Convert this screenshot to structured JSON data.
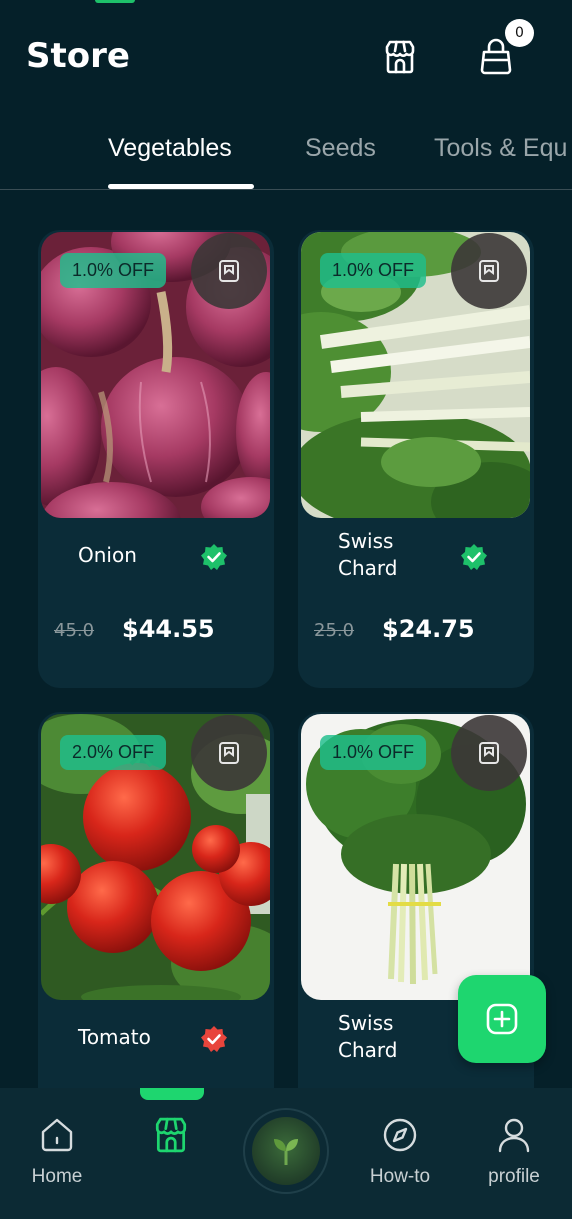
{
  "header": {
    "title": "Store",
    "cart_count": "0"
  },
  "tabs": [
    {
      "label": "Vegetables",
      "active": true
    },
    {
      "label": "Seeds",
      "active": false
    },
    {
      "label": "Tools & Equ",
      "active": false
    }
  ],
  "products": [
    {
      "name": "Onion",
      "discount": "1.0% OFF",
      "old_price": "45.0",
      "price": "$44.55",
      "verified_color": "#1ec16a"
    },
    {
      "name": "Swiss Chard",
      "name_line1": "Swiss",
      "name_line2": "Chard",
      "discount": "1.0% OFF",
      "old_price": "25.0",
      "price": "$24.75",
      "verified_color": "#1ec16a"
    },
    {
      "name": "Tomato",
      "discount": "2.0% OFF",
      "verified_color": "#e8453c"
    },
    {
      "name": "Swiss Chard",
      "name_line1": "Swiss",
      "name_line2": "Chard",
      "discount": "1.0% OFF"
    }
  ],
  "bottom_nav": {
    "home": "Home",
    "howto": "How-to",
    "profile": "profile"
  },
  "colors": {
    "accent": "#1ed66f",
    "background": "#052029",
    "card": "#0b2c38"
  }
}
